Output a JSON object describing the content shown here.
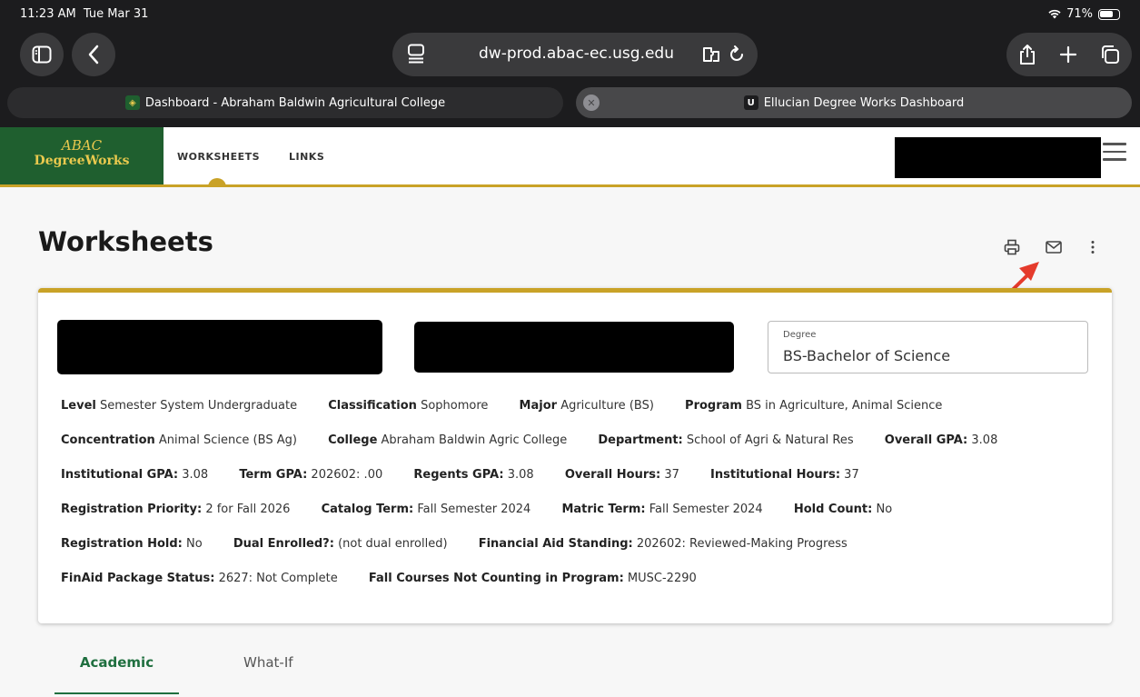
{
  "status": {
    "time": "11:23 AM",
    "date": "Tue Mar 31",
    "battery": "71%"
  },
  "browser": {
    "url": "dw-prod.abac-ec.usg.edu",
    "tabs": [
      {
        "label": "Dashboard - Abraham Baldwin Agricultural College"
      },
      {
        "label": "Ellucian Degree Works Dashboard",
        "favicon_letter": "U"
      }
    ]
  },
  "app": {
    "logo_line1": "ABAC",
    "logo_line2": "DegreeWorks",
    "nav": {
      "worksheets": "WORKSHEETS",
      "links": "LINKS"
    },
    "brand_green": "#1f5f2f",
    "brand_gold": "#c9a227"
  },
  "page": {
    "title": "Worksheets"
  },
  "degree": {
    "label": "Degree",
    "value": "BS-Bachelor of Science"
  },
  "info": {
    "level": {
      "label": "Level",
      "value": "Semester System Undergraduate"
    },
    "classification": {
      "label": "Classification",
      "value": "Sophomore"
    },
    "major": {
      "label": "Major",
      "value": "Agriculture (BS)"
    },
    "program": {
      "label": "Program",
      "value": "BS in Agriculture, Animal Science"
    },
    "concentration": {
      "label": "Concentration",
      "value": "Animal Science (BS Ag)"
    },
    "college": {
      "label": "College",
      "value": "Abraham Baldwin Agric College"
    },
    "department": {
      "label": "Department:",
      "value": "School of Agri & Natural Res"
    },
    "overall_gpa": {
      "label": "Overall GPA:",
      "value": "3.08"
    },
    "institutional_gpa": {
      "label": "Institutional GPA:",
      "value": "3.08"
    },
    "term_gpa": {
      "label": "Term GPA:",
      "value": "202602: .00"
    },
    "regents_gpa": {
      "label": "Regents GPA:",
      "value": "3.08"
    },
    "overall_hours": {
      "label": "Overall Hours:",
      "value": "37"
    },
    "institutional_hours": {
      "label": "Institutional Hours:",
      "value": "37"
    },
    "registration_priority": {
      "label": "Registration Priority:",
      "value": "2 for Fall 2026"
    },
    "catalog_term": {
      "label": "Catalog Term:",
      "value": "Fall Semester 2024"
    },
    "matric_term": {
      "label": "Matric Term:",
      "value": "Fall Semester 2024"
    },
    "hold_count": {
      "label": "Hold Count:",
      "value": "No"
    },
    "registration_hold": {
      "label": "Registration Hold:",
      "value": "No"
    },
    "dual_enrolled": {
      "label": "Dual Enrolled?:",
      "value": "(not dual enrolled)"
    },
    "financial_aid_standing": {
      "label": "Financial Aid Standing:",
      "value": "202602: Reviewed-Making Progress"
    },
    "finaid_package_status": {
      "label": "FinAid Package Status:",
      "value": "2627: Not Complete"
    },
    "fall_courses_not_counting": {
      "label": "Fall Courses Not Counting in Program:",
      "value": "MUSC-2290"
    }
  },
  "bottom_tabs": {
    "academic": "Academic",
    "whatif": "What-If"
  }
}
